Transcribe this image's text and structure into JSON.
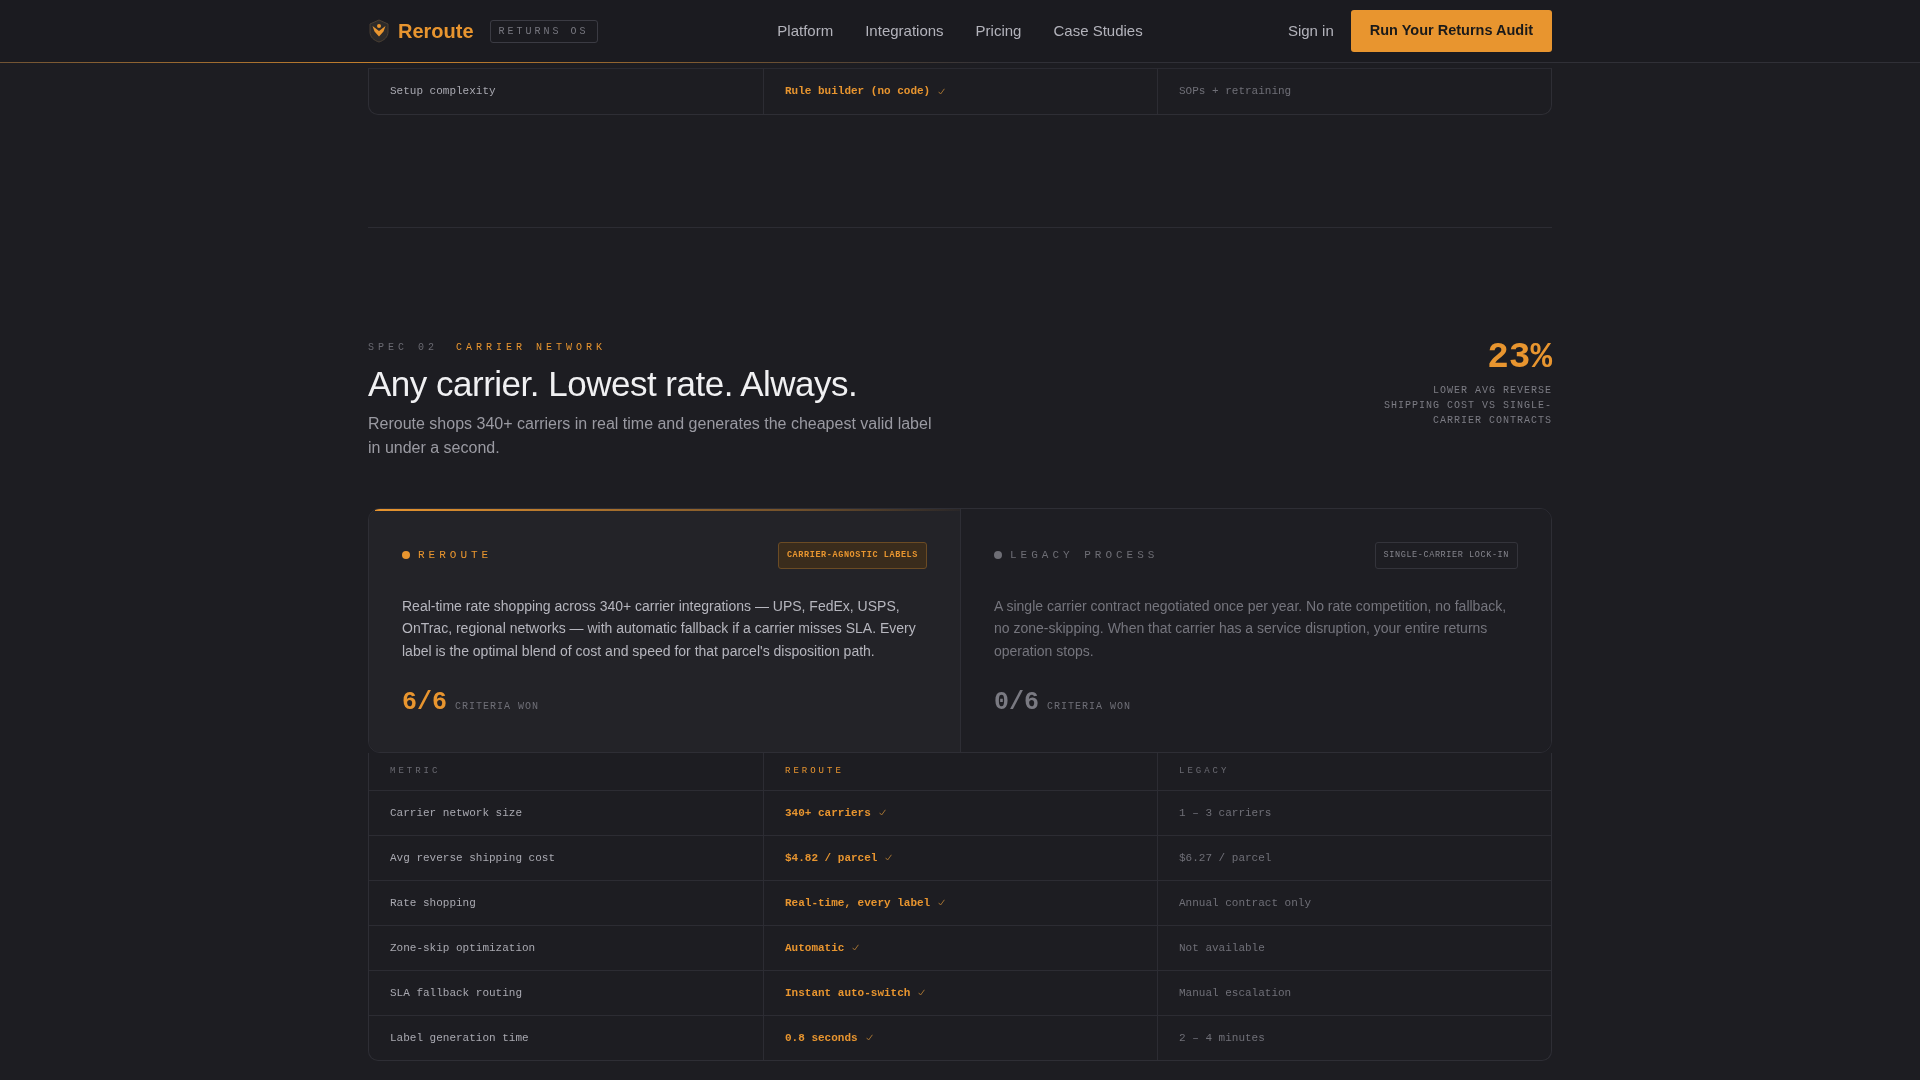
{
  "nav": {
    "brand": "Reroute",
    "brand_tag": "RETURNS OS",
    "links": [
      {
        "label": "Platform"
      },
      {
        "label": "Integrations"
      },
      {
        "label": "Pricing"
      },
      {
        "label": "Case Studies"
      }
    ],
    "sign_in": "Sign in",
    "cta": "Run Your Returns Audit"
  },
  "previous_table": {
    "rows": [
      {
        "metric": "Setup complexity",
        "reroute": "Rule builder (no code)",
        "legacy": "SOPs + retraining",
        "won": true
      }
    ]
  },
  "section": {
    "eyebrow_index": "SPEC 02",
    "eyebrow": "CARRIER NETWORK",
    "title": "Any carrier. Lowest rate. Always.",
    "lead": "Reroute shops 340+ carriers in real time and generates the cheapest valid label in under a second.",
    "stat": {
      "value": "23%",
      "caption": "LOWER AVG REVERSE SHIPPING COST VS SINGLE-CARRIER CONTRACTS"
    }
  },
  "cards": [
    {
      "kind": "winner",
      "name": "REROUTE",
      "color": "#e8952f",
      "tag": "CARRIER-AGNOSTIC LABELS",
      "body": "Real-time rate shopping across 340+ carrier integrations — UPS, FedEx, USPS, OnTrac, regional networks — with automatic fallback if a carrier misses SLA. Every label is the optimal blend of cost and speed for that parcel's disposition path.",
      "score": "6/6",
      "score_label": "CRITERIA WON"
    },
    {
      "kind": "legacy",
      "name": "LEGACY PROCESS",
      "color": "#6e6e75",
      "tag": "SINGLE-CARRIER LOCK-IN",
      "body": "A single carrier contract negotiated once per year. No rate competition, no fallback, no zone-skipping. When that carrier has a service disruption, your entire returns operation stops.",
      "score": "0/6",
      "score_label": "CRITERIA WON"
    }
  ],
  "table": {
    "columns": [
      "METRIC",
      "REROUTE",
      "LEGACY"
    ],
    "rows": [
      {
        "metric": "Carrier network size",
        "reroute": "340+ carriers",
        "legacy": "1 – 3 carriers",
        "won": true
      },
      {
        "metric": "Avg reverse shipping cost",
        "reroute": "$4.82 / parcel",
        "legacy": "$6.27 / parcel",
        "won": true
      },
      {
        "metric": "Rate shopping",
        "reroute": "Real-time, every label",
        "legacy": "Annual contract only",
        "won": true
      },
      {
        "metric": "Zone-skip optimization",
        "reroute": "Automatic",
        "legacy": "Not available",
        "won": true
      },
      {
        "metric": "SLA fallback routing",
        "reroute": "Instant auto-switch",
        "legacy": "Manual escalation",
        "won": true
      },
      {
        "metric": "Label generation time",
        "reroute": "0.8 seconds",
        "legacy": "2 – 4 minutes",
        "won": true
      }
    ]
  }
}
